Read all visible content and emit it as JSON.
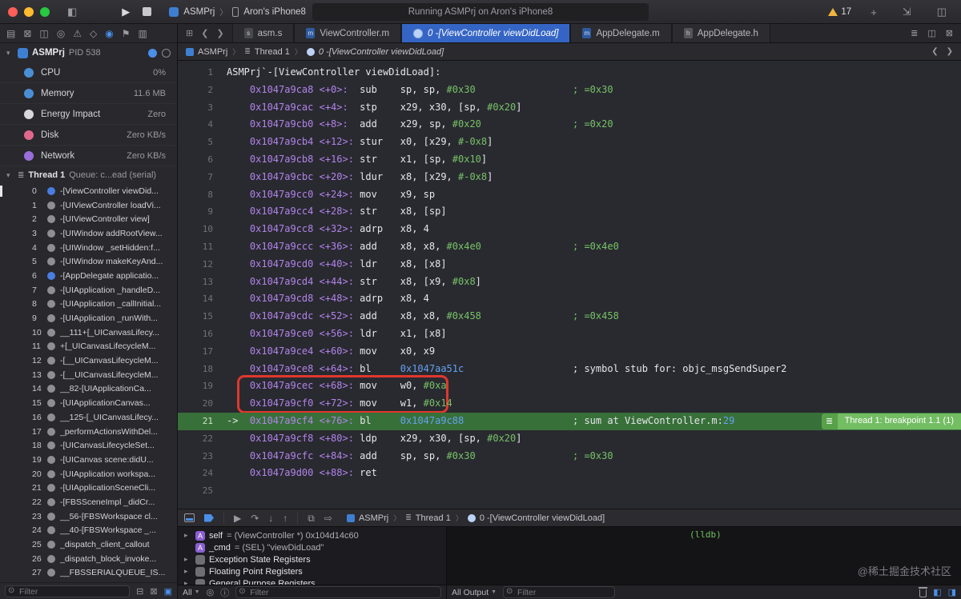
{
  "titlebar": {
    "scheme_name": "ASMPrj",
    "device_name": "Aron's iPhone8",
    "status_text": "Running ASMPrj on Aron's iPhone8",
    "warning_count": "17"
  },
  "tab_bar": {
    "tabs": [
      {
        "label": "asm.s",
        "icon": "s-file-icon",
        "badge": "s",
        "active": false
      },
      {
        "label": "ViewController.m",
        "icon": "m-file-icon",
        "badge": "m",
        "active": false
      },
      {
        "label": "0 -[ViewController viewDidLoad]",
        "icon": "debug-doc-icon",
        "badge": "",
        "active": true
      },
      {
        "label": "AppDelegate.m",
        "icon": "m-file-icon",
        "badge": "m",
        "active": false
      },
      {
        "label": "AppDelegate.h",
        "icon": "h-file-icon",
        "badge": "h",
        "active": false
      }
    ]
  },
  "jump_bar": {
    "crumbs": [
      "ASMPrj",
      "Thread 1",
      "0 -[ViewController viewDidLoad]"
    ]
  },
  "sidebar": {
    "process": {
      "name": "ASMPrj",
      "pid": "PID 538"
    },
    "gauges": [
      {
        "label": "CPU",
        "value": "0%",
        "color": "#4a8fd4"
      },
      {
        "label": "Memory",
        "value": "11.6 MB",
        "color": "#4a8fd4"
      },
      {
        "label": "Energy Impact",
        "value": "Zero",
        "color": "#d8d8dc"
      },
      {
        "label": "Disk",
        "value": "Zero KB/s",
        "color": "#e2688b"
      },
      {
        "label": "Network",
        "value": "Zero KB/s",
        "color": "#9a6ed8"
      }
    ],
    "thread": {
      "name": "Thread 1",
      "queue": "Queue: c...ead (serial)"
    },
    "frames": [
      {
        "n": "0",
        "label": "-[ViewController viewDid...",
        "user": true,
        "current": true
      },
      {
        "n": "1",
        "label": "-[UIViewController loadVi...",
        "user": false
      },
      {
        "n": "2",
        "label": "-[UIViewController view]",
        "user": false
      },
      {
        "n": "3",
        "label": "-[UIWindow addRootView...",
        "user": false
      },
      {
        "n": "4",
        "label": "-[UIWindow _setHidden:f...",
        "user": false
      },
      {
        "n": "5",
        "label": "-[UIWindow makeKeyAnd...",
        "user": false
      },
      {
        "n": "6",
        "label": "-[AppDelegate applicatio...",
        "user": true
      },
      {
        "n": "7",
        "label": "-[UIApplication _handleD...",
        "user": false
      },
      {
        "n": "8",
        "label": "-[UIApplication _callInitial...",
        "user": false
      },
      {
        "n": "9",
        "label": "-[UIApplication _runWith...",
        "user": false
      },
      {
        "n": "10",
        "label": "__111+[_UICanvasLifecy...",
        "user": false
      },
      {
        "n": "11",
        "label": "+[_UICanvasLifecycleM...",
        "user": false
      },
      {
        "n": "12",
        "label": "-[__UICanvasLifecycleM...",
        "user": false
      },
      {
        "n": "13",
        "label": "-[__UICanvasLifecycleM...",
        "user": false
      },
      {
        "n": "14",
        "label": "__82-[UIApplicationCa...",
        "user": false
      },
      {
        "n": "15",
        "label": "-[UIApplicationCanvas...",
        "user": false
      },
      {
        "n": "16",
        "label": "__125-[_UICanvasLifecy...",
        "user": false
      },
      {
        "n": "17",
        "label": "_performActionsWithDel...",
        "user": false
      },
      {
        "n": "18",
        "label": "-[UICanvasLifecycleSet...",
        "user": false
      },
      {
        "n": "19",
        "label": "-[UICanvas scene:didU...",
        "user": false
      },
      {
        "n": "20",
        "label": "-[UIApplication workspa...",
        "user": false
      },
      {
        "n": "21",
        "label": "-[UIApplicationSceneCli...",
        "user": false
      },
      {
        "n": "22",
        "label": "-[FBSSceneImpl _didCr...",
        "user": false
      },
      {
        "n": "23",
        "label": "__56-[FBSWorkspace cl...",
        "user": false
      },
      {
        "n": "24",
        "label": "__40-[FBSWorkspace _...",
        "user": false
      },
      {
        "n": "25",
        "label": "_dispatch_client_callout",
        "user": false
      },
      {
        "n": "26",
        "label": "_dispatch_block_invoke...",
        "user": false
      },
      {
        "n": "27",
        "label": "__FBSSERIALQUEUE_IS...",
        "user": false
      }
    ],
    "filter_placeholder": "Filter"
  },
  "editor": {
    "breakpoint_badge": "Thread 1: breakpoint 1.1 (1)",
    "lines": [
      {
        "n": "1",
        "code": [
          [
            "w",
            "ASMPrj`-[ViewController viewDidLoad]:"
          ]
        ]
      },
      {
        "n": "2",
        "code": [
          [
            "a",
            "    0x1047a9ca8 <+0>:  "
          ],
          [
            "w",
            "sub    sp, sp, "
          ],
          [
            "g",
            "#0x30"
          ]
        ],
        "cmt": [
          [
            "g",
            "; =0x30"
          ]
        ]
      },
      {
        "n": "3",
        "code": [
          [
            "a",
            "    0x1047a9cac <+4>:  "
          ],
          [
            "w",
            "stp    x29, x30, [sp, "
          ],
          [
            "g",
            "#0x20"
          ],
          [
            "w",
            "]"
          ]
        ]
      },
      {
        "n": "4",
        "code": [
          [
            "a",
            "    0x1047a9cb0 <+8>:  "
          ],
          [
            "w",
            "add    x29, sp, "
          ],
          [
            "g",
            "#0x20"
          ]
        ],
        "cmt": [
          [
            "g",
            "; =0x20"
          ]
        ]
      },
      {
        "n": "5",
        "code": [
          [
            "a",
            "    0x1047a9cb4 <+12>: "
          ],
          [
            "w",
            "stur   x0, [x29, "
          ],
          [
            "g",
            "#-0x8"
          ],
          [
            "w",
            "]"
          ]
        ]
      },
      {
        "n": "6",
        "code": [
          [
            "a",
            "    0x1047a9cb8 <+16>: "
          ],
          [
            "w",
            "str    x1, [sp, "
          ],
          [
            "g",
            "#0x10"
          ],
          [
            "w",
            "]"
          ]
        ]
      },
      {
        "n": "7",
        "code": [
          [
            "a",
            "    0x1047a9cbc <+20>: "
          ],
          [
            "w",
            "ldur   x8, [x29, "
          ],
          [
            "g",
            "#-0x8"
          ],
          [
            "w",
            "]"
          ]
        ]
      },
      {
        "n": "8",
        "code": [
          [
            "a",
            "    0x1047a9cc0 <+24>: "
          ],
          [
            "w",
            "mov    x9, sp"
          ]
        ]
      },
      {
        "n": "9",
        "code": [
          [
            "a",
            "    0x1047a9cc4 <+28>: "
          ],
          [
            "w",
            "str    x8, [sp]"
          ]
        ]
      },
      {
        "n": "10",
        "code": [
          [
            "a",
            "    0x1047a9cc8 <+32>: "
          ],
          [
            "w",
            "adrp   x8, 4"
          ]
        ]
      },
      {
        "n": "11",
        "code": [
          [
            "a",
            "    0x1047a9ccc <+36>: "
          ],
          [
            "w",
            "add    x8, x8, "
          ],
          [
            "g",
            "#0x4e0"
          ]
        ],
        "cmt": [
          [
            "g",
            "; =0x4e0"
          ]
        ]
      },
      {
        "n": "12",
        "code": [
          [
            "a",
            "    0x1047a9cd0 <+40>: "
          ],
          [
            "w",
            "ldr    x8, [x8]"
          ]
        ]
      },
      {
        "n": "13",
        "code": [
          [
            "a",
            "    0x1047a9cd4 <+44>: "
          ],
          [
            "w",
            "str    x8, [x9, "
          ],
          [
            "g",
            "#0x8"
          ],
          [
            "w",
            "]"
          ]
        ]
      },
      {
        "n": "14",
        "code": [
          [
            "a",
            "    0x1047a9cd8 <+48>: "
          ],
          [
            "w",
            "adrp   x8, 4"
          ]
        ]
      },
      {
        "n": "15",
        "code": [
          [
            "a",
            "    0x1047a9cdc <+52>: "
          ],
          [
            "w",
            "add    x8, x8, "
          ],
          [
            "g",
            "#0x458"
          ]
        ],
        "cmt": [
          [
            "g",
            "; =0x458"
          ]
        ]
      },
      {
        "n": "16",
        "code": [
          [
            "a",
            "    0x1047a9ce0 <+56>: "
          ],
          [
            "w",
            "ldr    x1, [x8]"
          ]
        ]
      },
      {
        "n": "17",
        "code": [
          [
            "a",
            "    0x1047a9ce4 <+60>: "
          ],
          [
            "w",
            "mov    x0, x9"
          ]
        ]
      },
      {
        "n": "18",
        "code": [
          [
            "a",
            "    0x1047a9ce8 <+64>: "
          ],
          [
            "w",
            "bl     "
          ],
          [
            "b",
            "0x1047aa51c"
          ]
        ],
        "cmt": [
          [
            "w",
            "; symbol stub for: objc_msgSendSuper2"
          ]
        ]
      },
      {
        "n": "19",
        "code": [
          [
            "a",
            "    0x1047a9cec <+68>: "
          ],
          [
            "w",
            "mov    w0, "
          ],
          [
            "g",
            "#0xa"
          ]
        ]
      },
      {
        "n": "20",
        "code": [
          [
            "a",
            "    0x1047a9cf0 <+72>: "
          ],
          [
            "w",
            "mov    w1, "
          ],
          [
            "g",
            "#0x14"
          ]
        ]
      },
      {
        "n": "21",
        "hl": true,
        "code": [
          [
            "w",
            "->  "
          ],
          [
            "a",
            "0x1047a9cf4 <+76>: "
          ],
          [
            "w",
            "bl     "
          ],
          [
            "b",
            "0x1047a9c88"
          ]
        ],
        "cmt": [
          [
            "w",
            "; sum at ViewController.m:"
          ],
          [
            "b",
            "29"
          ]
        ]
      },
      {
        "n": "22",
        "code": [
          [
            "a",
            "    0x1047a9cf8 <+80>: "
          ],
          [
            "w",
            "ldp    x29, x30, [sp, "
          ],
          [
            "g",
            "#0x20"
          ],
          [
            "w",
            "]"
          ]
        ]
      },
      {
        "n": "23",
        "code": [
          [
            "a",
            "    0x1047a9cfc <+84>: "
          ],
          [
            "w",
            "add    sp, sp, "
          ],
          [
            "g",
            "#0x30"
          ]
        ],
        "cmt": [
          [
            "g",
            "; =0x30"
          ]
        ]
      },
      {
        "n": "24",
        "code": [
          [
            "a",
            "    0x1047a9d00 <+88>: "
          ],
          [
            "w",
            "ret"
          ]
        ]
      },
      {
        "n": "25",
        "code": []
      }
    ]
  },
  "debug_bar": {
    "crumbs": [
      "ASMPrj",
      "Thread 1",
      "0 -[ViewController viewDidLoad]"
    ]
  },
  "variables_pane": {
    "items": [
      {
        "badge": "A",
        "name": "self",
        "value": "= (ViewController *) 0x104d14c60",
        "expandable": true
      },
      {
        "badge": "A",
        "name": "_cmd",
        "value": "= (SEL) \"viewDidLoad\"",
        "expandable": false
      },
      {
        "badge": "",
        "name": "Exception State Registers",
        "value": "",
        "expandable": true
      },
      {
        "badge": "",
        "name": "Floating Point Registers",
        "value": "",
        "expandable": true
      },
      {
        "badge": "",
        "name": "General Purpose Registers",
        "value": "",
        "expandable": true
      }
    ],
    "scope_label": "All",
    "filter_placeholder": "Filter"
  },
  "console_pane": {
    "prompt": "(lldb)",
    "scope_label": "All Output",
    "filter_placeholder": "Filter"
  },
  "watermark": "@稀土掘金技术社区"
}
